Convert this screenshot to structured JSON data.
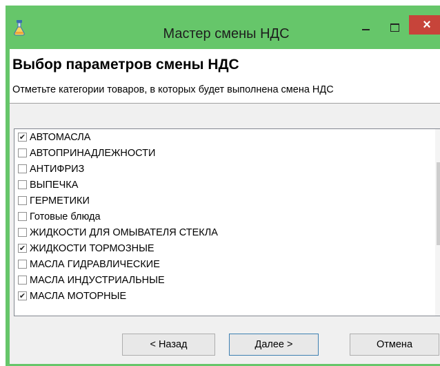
{
  "window": {
    "title": "Мастер смены НДС",
    "close_glyph": "×"
  },
  "header": {
    "title": "Выбор параметров смены НДС",
    "subtitle": "Отметьте категории товаров, в которых будет выполнена смена НДС"
  },
  "categories": [
    {
      "label": "АВТОМАСЛА",
      "checked": true
    },
    {
      "label": "АВТОПРИНАДЛЕЖНОСТИ",
      "checked": false
    },
    {
      "label": "АНТИФРИЗ",
      "checked": false
    },
    {
      "label": "ВЫПЕЧКА",
      "checked": false
    },
    {
      "label": "ГЕРМЕТИКИ",
      "checked": false
    },
    {
      "label": "Готовые блюда",
      "checked": false
    },
    {
      "label": "ЖИДКОСТИ ДЛЯ ОМЫВАТЕЛЯ СТЕКЛА",
      "checked": false
    },
    {
      "label": "ЖИДКОСТИ ТОРМОЗНЫЕ",
      "checked": true
    },
    {
      "label": "МАСЛА ГИДРАВЛИЧЕСКИЕ",
      "checked": false
    },
    {
      "label": "МАСЛА ИНДУСТРИАЛЬНЫЕ",
      "checked": false
    },
    {
      "label": "МАСЛА МОТОРНЫЕ",
      "checked": true
    }
  ],
  "buttons": {
    "back": "< Назад",
    "next": "Далее >",
    "cancel": "Отмена"
  },
  "icons": {
    "app": "flask-icon",
    "checkmark": "checkmark-icon"
  },
  "colors": {
    "title_bar": "#66c66a",
    "close_button": "#c7443a",
    "client_background": "#f0f0f0"
  }
}
